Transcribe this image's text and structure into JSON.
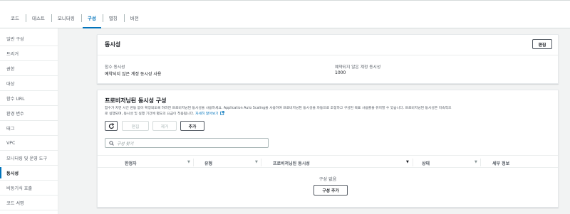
{
  "tabs": [
    {
      "label": "코드"
    },
    {
      "label": "테스트"
    },
    {
      "label": "모니터링"
    },
    {
      "label": "구성"
    },
    {
      "label": "별칭"
    },
    {
      "label": "버전"
    }
  ],
  "sidebar": {
    "items": [
      {
        "label": "일반 구성"
      },
      {
        "label": "트리거"
      },
      {
        "label": "권한"
      },
      {
        "label": "대상"
      },
      {
        "label": "함수 URL"
      },
      {
        "label": "환경 변수"
      },
      {
        "label": "태그"
      },
      {
        "label": "VPC"
      },
      {
        "label": "모니터링 및 운영 도구"
      },
      {
        "label": "동시성"
      },
      {
        "label": "비동기식 호출"
      },
      {
        "label": "코드 서명"
      }
    ],
    "active_index": 9
  },
  "concurrency": {
    "title": "동시성",
    "edit_label": "편집",
    "function_concurrency_label": "함수 동시성",
    "function_concurrency_value": "예약되지 않은 계정 동시성 사용",
    "unreserved_label": "예약되지 않은 계정 동시성",
    "unreserved_value": "1000"
  },
  "provisioned": {
    "title": "프로비저닝된 동시성 구성",
    "description": "함수가 지연 시간 변동 없이 확장되도록 하려면 프로비저닝된 동시성을 사용하세요. Application Auto Scaling을 사용하여 프로비저닝된 동시성을 자동으로 조정하고 구성된 목표 사용률을 유지할 수 있습니다. 프로비저닝된 동시성은 지속적으",
    "description_line2": "로 실행되며, 동시성 및 실행 기간에 별도의 요금이 적용됩니다.",
    "learn_more": "자세히 알아보기",
    "refresh_icon": "refresh-icon",
    "edit_label": "편집",
    "remove_label": "제거",
    "add_label": "추가",
    "search_placeholder": "구성 찾기",
    "columns": [
      "한정자",
      "유형",
      "프로비저닝된 동시성",
      "상태",
      "세부 정보"
    ],
    "empty_text": "구성 없음",
    "empty_add_label": "구성 추가"
  },
  "colors": {
    "accent": "#0073bb",
    "text": "#16191f",
    "muted": "#545b64",
    "background": "#f2f3f3"
  }
}
